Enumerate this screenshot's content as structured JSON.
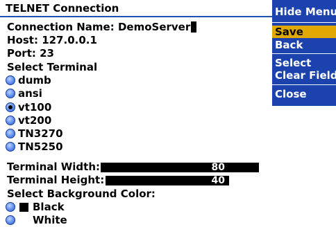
{
  "title": "TELNET Connection",
  "connection": {
    "name_label": "Connection Name: ",
    "name_value": "DemoServer",
    "host_label": "Host: ",
    "host_value": "127.0.0.1",
    "port_label": "Port: ",
    "port_value": "23"
  },
  "terminal": {
    "label": "Select Terminal",
    "options": [
      {
        "label": "dumb",
        "selected": false
      },
      {
        "label": "ansi",
        "selected": false
      },
      {
        "label": "vt100",
        "selected": true
      },
      {
        "label": "vt200",
        "selected": false
      },
      {
        "label": "TN3270",
        "selected": false
      },
      {
        "label": "TN5250",
        "selected": false
      }
    ],
    "width_label": "Terminal Width:",
    "width_value": "80",
    "height_label": "Terminal Height:",
    "height_value": "40"
  },
  "background": {
    "label": "Select Background Color:",
    "options": [
      {
        "label": "Black",
        "swatch": "#000000"
      },
      {
        "label": "White",
        "swatch": "#ffffff"
      }
    ]
  },
  "menu": {
    "items": [
      {
        "label": "Hide Menu"
      },
      {
        "label": "Save"
      },
      {
        "label": "Back"
      },
      {
        "label": "Select"
      },
      {
        "label": "Clear Field"
      },
      {
        "label": "Close"
      }
    ],
    "highlighted": "Save",
    "background": "#1c43ad",
    "highlight_color": "#e1a800"
  },
  "colors": {
    "title_underline": "#1f4fb8",
    "radio": "#2a5bd0"
  }
}
